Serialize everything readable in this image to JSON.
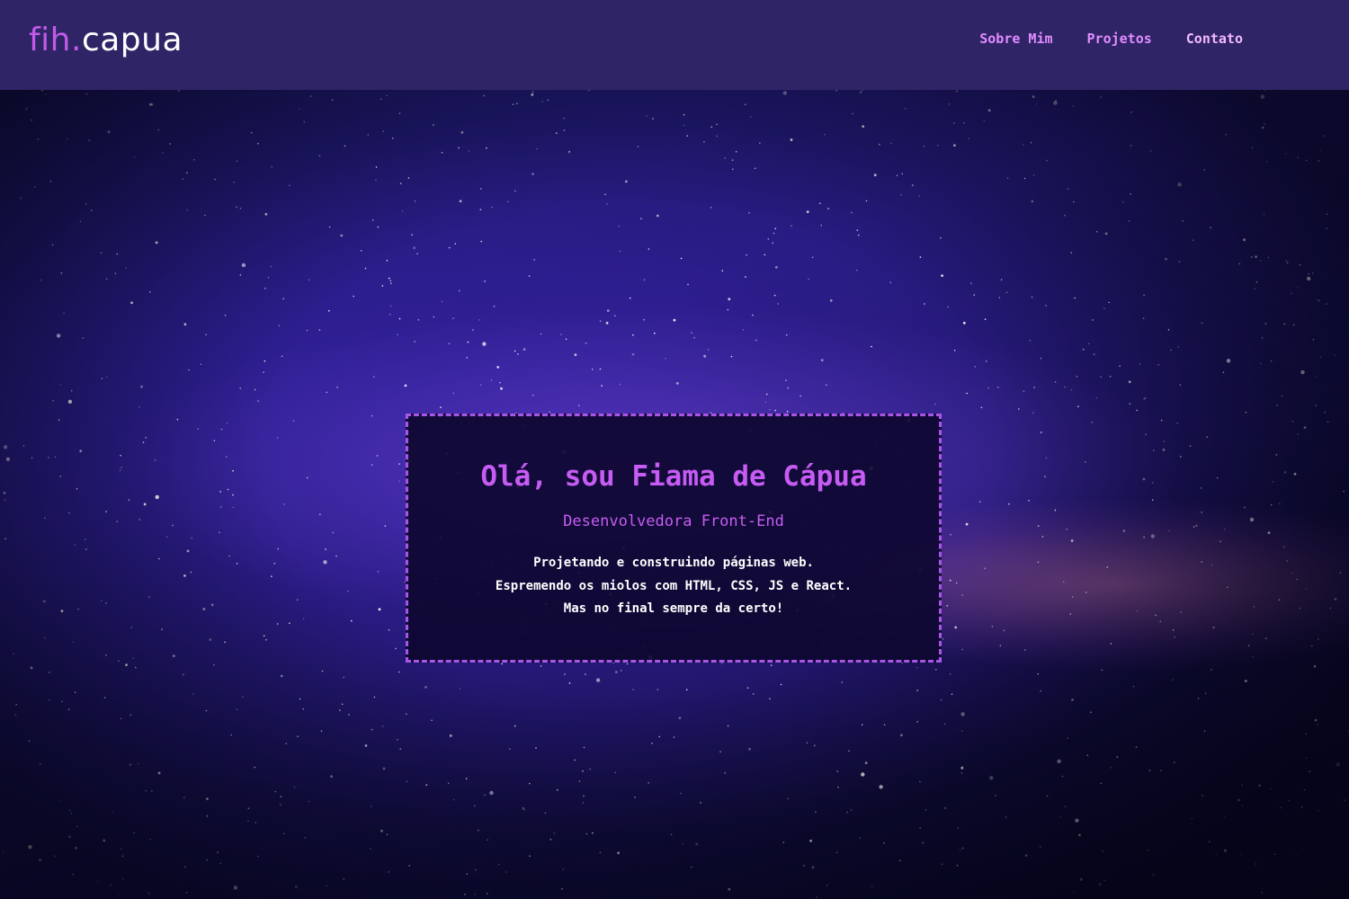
{
  "navbar": {
    "logo_prefix": "fih.",
    "logo_suffix": "capua",
    "links": [
      {
        "label": "Sobre Mim"
      },
      {
        "label": "Projetos"
      },
      {
        "label": "Contato"
      }
    ]
  },
  "hero": {
    "title": "Olá, sou Fiama de Cápua",
    "subtitle": "Desenvolvedora Front-End",
    "lines": [
      "Projetando e construindo páginas web.",
      "Espremendo os miolos com HTML, CSS, JS e React.",
      "Mas no final sempre da certo!"
    ]
  },
  "colors": {
    "navbar_bg": "#2f2466",
    "accent": "#c65cf3",
    "nav_link": "#e18cff",
    "card_border": "#a855e8",
    "text": "#ffffff"
  }
}
